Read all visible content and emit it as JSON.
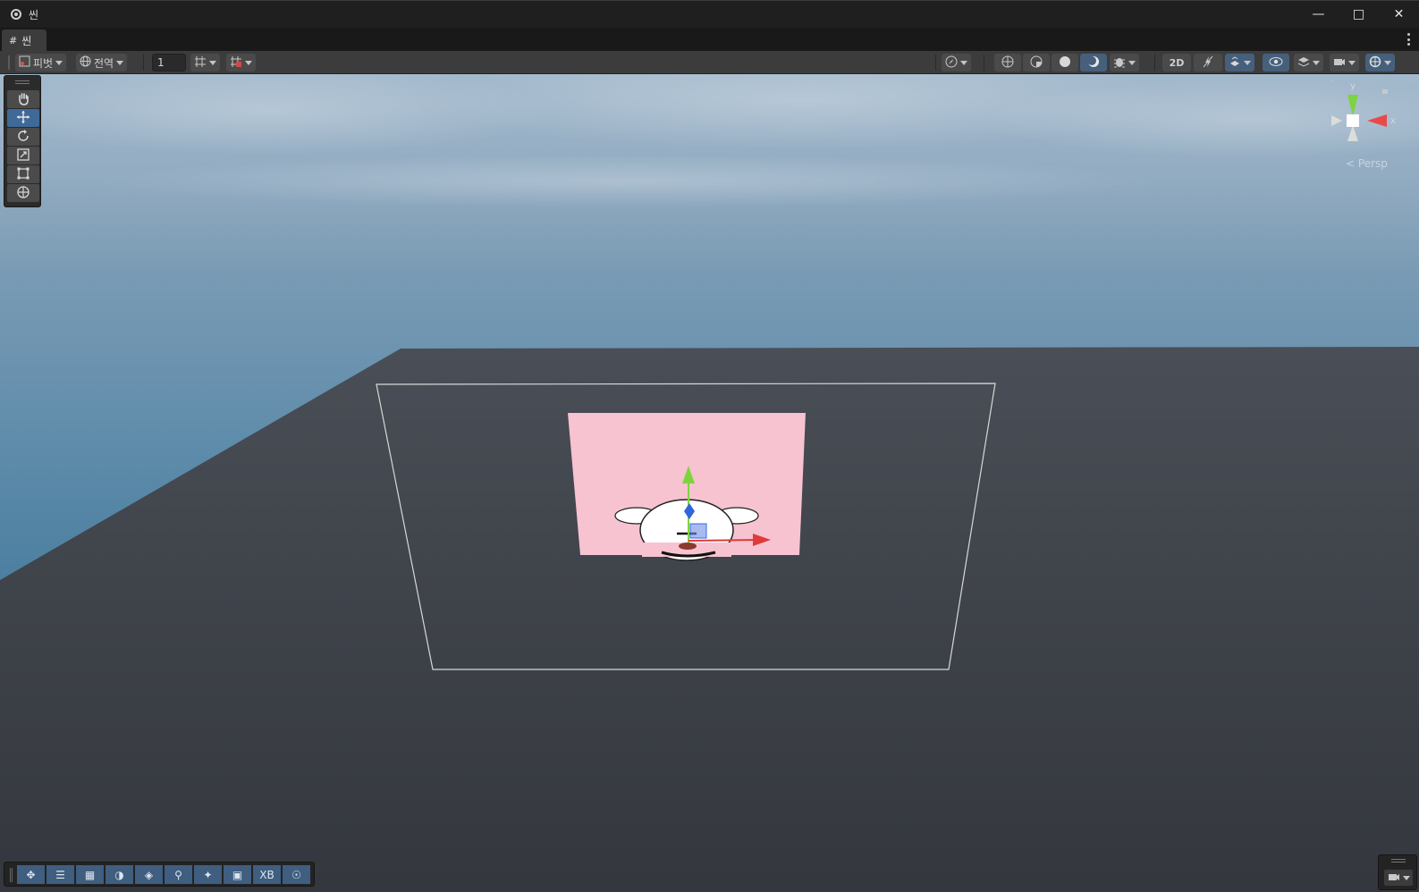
{
  "window": {
    "title": "씬",
    "controls": [
      "minimize-icon",
      "maximize-icon",
      "close-icon"
    ]
  },
  "tab": {
    "label": "씬"
  },
  "toolbar": {
    "pivot_label": "피벗",
    "global_label": "전역",
    "grid_increment": "1"
  },
  "viewport": {
    "projection_label": "Persp",
    "axis_y": "y",
    "axis_x": "x",
    "sky_color_top": "#9fb5c8",
    "sky_color_horizon": "#4e7f9e",
    "ground_color": "#3f4249",
    "selected_object_color": "#f7c3d0"
  },
  "tools": [
    "hand-icon",
    "move-icon",
    "rotate-icon",
    "scale-icon",
    "rect-icon",
    "transform-icon"
  ],
  "active_tool": "move-icon",
  "bottom_overlay": {
    "xb_label": "XB"
  }
}
